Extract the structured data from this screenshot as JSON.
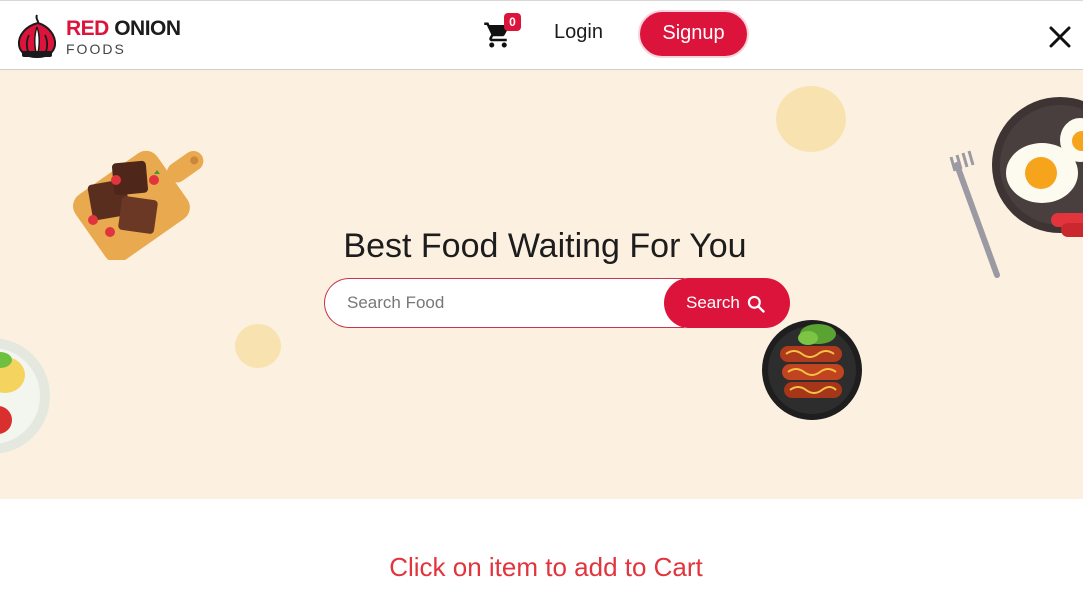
{
  "brand": {
    "name_red": "RED",
    "name_dark": "ONION",
    "subtitle": "FOODS",
    "accent_color": "#dc143c"
  },
  "nav": {
    "cart_icon": "shopping-cart-icon",
    "cart_count": "0",
    "login_label": "Login",
    "signup_label": "Signup",
    "close_icon": "close-icon"
  },
  "hero": {
    "title": "Best Food Waiting For You",
    "search": {
      "placeholder": "Search Food",
      "value": "",
      "button_label": "Search",
      "button_icon": "search-icon"
    },
    "background_color": "#fcf1e0"
  },
  "footer": {
    "hint": "Click on item to add to Cart"
  }
}
